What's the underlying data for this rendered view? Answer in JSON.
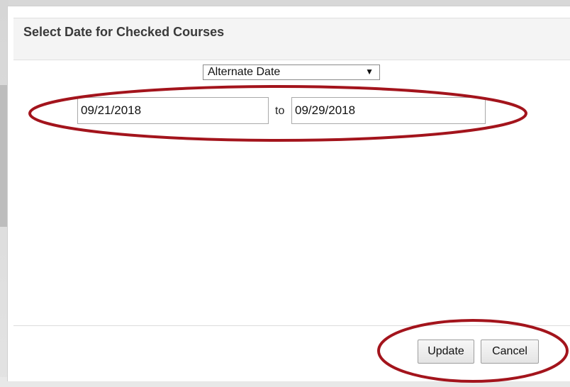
{
  "dialog": {
    "title": "Select Date for Checked Courses",
    "date_type_select": {
      "value": "Alternate Date"
    },
    "from_date": "09/21/2018",
    "to_label": "to",
    "to_date": "09/29/2018"
  },
  "footer": {
    "update_label": "Update",
    "cancel_label": "Cancel"
  },
  "annotation_color": "#a3141c"
}
